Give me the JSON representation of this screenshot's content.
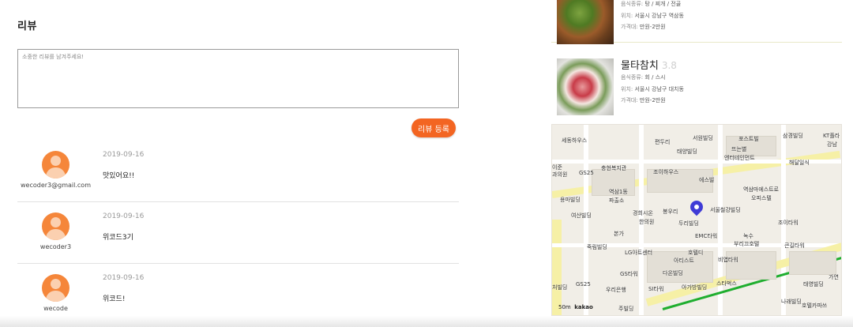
{
  "review": {
    "title": "리뷰",
    "placeholder": "소중한 리뷰를 남겨주세요!",
    "submit_label": "리뷰 등록",
    "items": [
      {
        "date": "2019-09-16",
        "text": "맛있어요!!",
        "user": "wecoder3@gmail.com"
      },
      {
        "date": "2019-09-16",
        "text": "위코드3기",
        "user": "wecoder3"
      },
      {
        "date": "2019-09-16",
        "text": "위코드!",
        "user": "wecode"
      }
    ]
  },
  "restaurants": [
    {
      "name": "",
      "rating": "",
      "category_label": "음식종류:",
      "category": "탕 / 찌개 / 전골",
      "location_label": "위치:",
      "location": "서울시 강남구 역삼동",
      "price_label": "가격대:",
      "price": "만원-2만원"
    },
    {
      "name": "물타참치",
      "rating": "3.8",
      "category_label": "음식종류:",
      "category": "회 / 스시",
      "location_label": "위치:",
      "location": "서울시 강남구 대치동",
      "price_label": "가격대:",
      "price": "만원-2만원"
    }
  ],
  "map": {
    "labels": {
      "sedong": "세동하우스",
      "pyeonu": "편두리",
      "seowon": "서원빌딩",
      "post": "포스트빌",
      "samgyeong": "삼경빌딩",
      "kt": "KT플라",
      "gangnam": "강남",
      "taeyang1": "태양빌딩",
      "ddeuneun": "뜨는별",
      "entertainment": "엔터테인먼트",
      "haedal": "해달일식",
      "ijun": "이준",
      "gwaeuiwon": "과의원",
      "gs25a": "GS25",
      "chunghyeon": "충현복지관",
      "joi": "조이하우스",
      "eseuvil": "에스빌",
      "yeoksam": "역삼1동",
      "pachulso": "파출소",
      "yeoksammi": "역삼마에스트로",
      "office": "오피스텔",
      "yongma": "용마빌딩",
      "gyeongchi": "경희시온",
      "hanuiwon": "한의원",
      "bongu": "봉우리",
      "seoulsteel": "서울철강빌딩",
      "yeosan": "여산빌딩",
      "duri": "두리빌딩",
      "joitower": "조이타워",
      "bonga": "본가",
      "emc": "EMC타워",
      "noksu": "녹수",
      "buri": "부리끄호텔",
      "keungil": "큰길타워",
      "jukrim": "죽림빌딩",
      "lg": "LG아트센터",
      "hotel": "호텔디",
      "artist": "아티스트",
      "biyeol": "비엽타워",
      "gstower": "GS타워",
      "daon": "다온빌딩",
      "gs25b": "GS25",
      "woori": "우리은행",
      "sitower": "SI타워",
      "agabang": "아가방빌딩",
      "starbucks": "스타벅스",
      "taeyoung": "태영빌딩",
      "gayeon": "가연",
      "naehwa": "나래빌딩",
      "hotelka": "호텔카파쓰",
      "kakao": "kakao",
      "scale": "50m",
      "chaewon": "처빌딩",
      "jjuipo": "주빌딩"
    }
  }
}
